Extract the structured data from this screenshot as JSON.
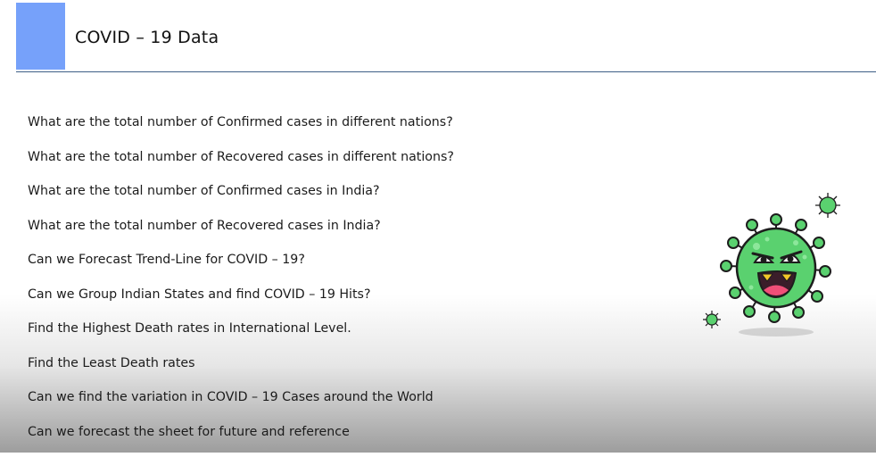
{
  "slide": {
    "title": "COVID – 19 Data",
    "accent_color": "#76a1fa",
    "rule_color": "#3d5e86"
  },
  "questions": [
    "What are the total number of Confirmed cases in different nations?",
    "What are the total number of Recovered cases in different nations?",
    "What are the total number of Confirmed cases in India?",
    "What are the total number of Recovered cases in India?",
    "Can we Forecast Trend-Line for COVID – 19?",
    "Can we Group Indian States and find COVID – 19  Hits?",
    "Find the Highest Death rates in International Level.",
    "Find the Least Death rates",
    "Can we find the variation in COVID – 19 Cases around the World",
    "Can we forecast the sheet for future and reference"
  ],
  "illustration": {
    "name": "cartoon-virus-icon",
    "virus_color": "#5ad16f",
    "outline_color": "#1d1d1d"
  }
}
